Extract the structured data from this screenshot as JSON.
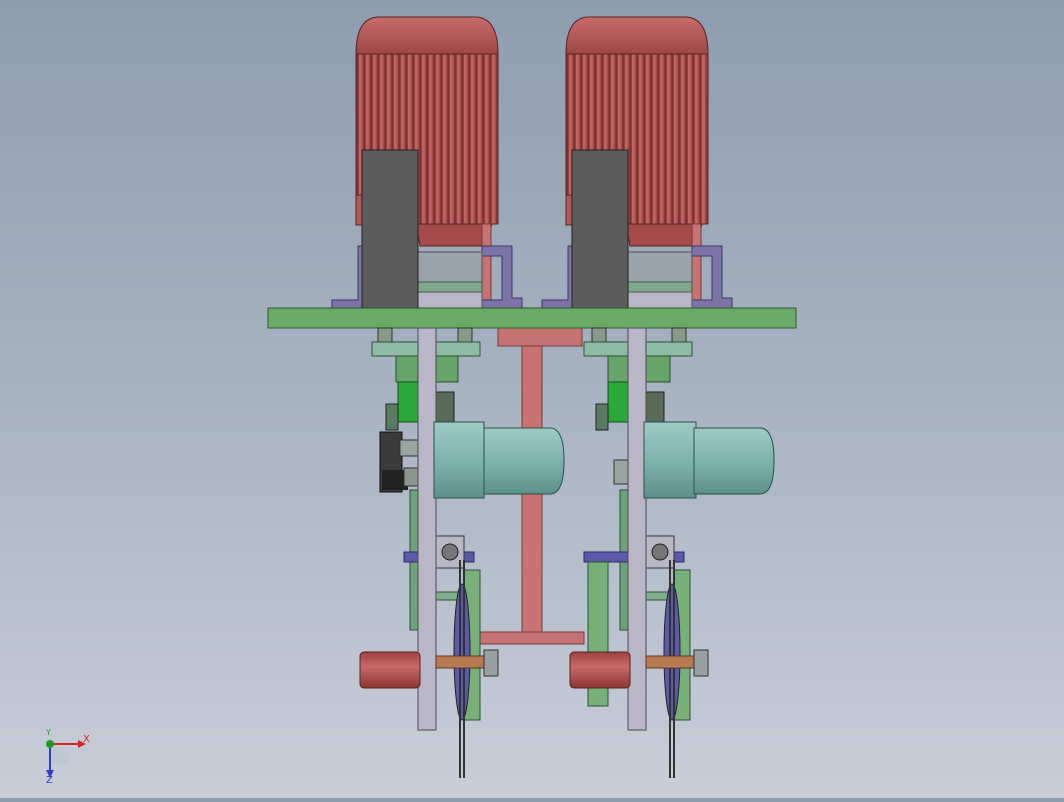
{
  "triad": {
    "x_label": "X",
    "y_label": "Y",
    "z_label": "Z",
    "x_color": "#d8262a",
    "y_color": "#1f9a2a",
    "z_color": "#2a3fc8"
  },
  "colors": {
    "motor_red": "#b85a5a",
    "plate_green": "#6aaa66",
    "frame_grey": "#b9b7c6",
    "bracket_purple": "#7d73a8",
    "gear_motor_teal": "#7fb3ad",
    "roller_red": "#b8585a",
    "shaft_bronze": "#b77a52",
    "pipe_salmon": "#c87373",
    "dark_plate": "#5c5c5c"
  }
}
